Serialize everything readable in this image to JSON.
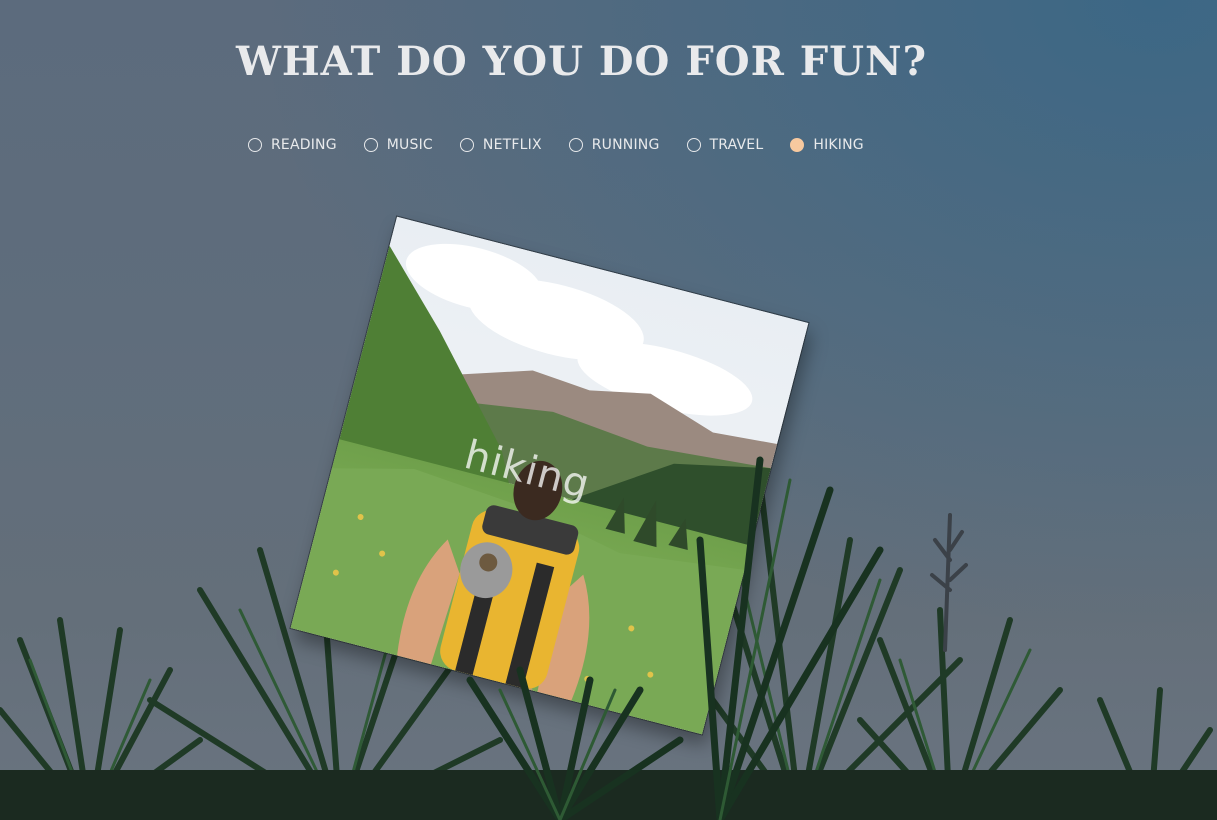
{
  "heading": "WHAT DO YOU DO FOR FUN?",
  "options": [
    {
      "label": "READING",
      "checked": false
    },
    {
      "label": "MUSIC",
      "checked": false
    },
    {
      "label": "NETFLIX",
      "checked": false
    },
    {
      "label": "RUNNING",
      "checked": false
    },
    {
      "label": "TRAVEL",
      "checked": false
    },
    {
      "label": "HIKING",
      "checked": true
    }
  ],
  "photo": {
    "caption": "hiking",
    "icon": "hiker-photo"
  },
  "colors": {
    "accent_selected": "#f7c99f",
    "text": "#e8eaec"
  }
}
